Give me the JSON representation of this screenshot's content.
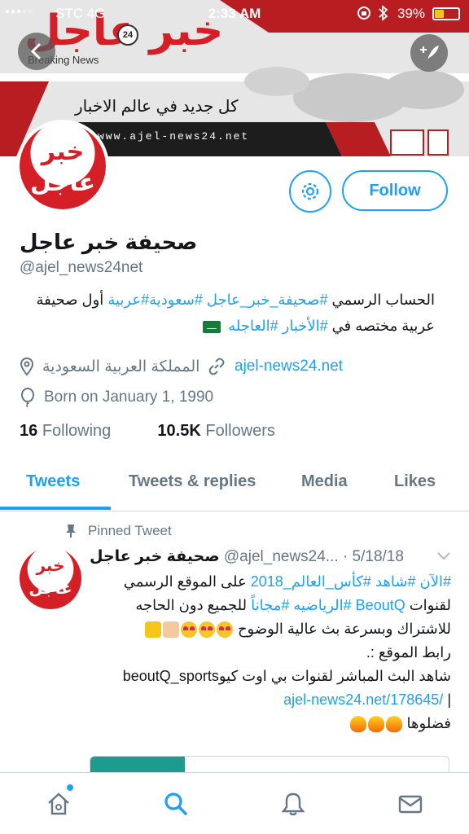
{
  "status_bar": {
    "signal_dots": "●●●○○",
    "carrier": "STC  4G",
    "time": "2:33 AM",
    "battery_percent": "39%",
    "battery_level": 0.39
  },
  "banner": {
    "logo_text": "خبر عاجل",
    "logo_badge": "24",
    "subtitle": "Breaking News",
    "tagline": "كل جديد في عالم الاخبار",
    "url": "www.ajel-news24.net"
  },
  "avatar": {
    "line1": "خبر",
    "line2": "عاجل"
  },
  "profile": {
    "follow_label": "Follow",
    "display_name": "صحيفة خبر عاجل",
    "handle": "@ajel_news24net",
    "bio_part1": "الحساب الرسمي ",
    "bio_tag1": "#صحيفة_خبر_عاجل",
    "bio_tag2": "#سعودية",
    "bio_tag3": "#عربية",
    "bio_part2": " أول صحيفة عربية مختصه في ",
    "bio_tag4": "#الأخبار",
    "bio_tag5": "#العاجله",
    "location": "المملكة العربية السعودية",
    "website": "ajel-news24.net",
    "born": "Born on January 1, 1990",
    "following_count": "16",
    "following_label": "Following",
    "followers_count": "10.5K",
    "followers_label": "Followers"
  },
  "tabs": [
    {
      "label": "Tweets",
      "active": true
    },
    {
      "label": "Tweets & replies",
      "active": false
    },
    {
      "label": "Media",
      "active": false
    },
    {
      "label": "Likes",
      "active": false
    }
  ],
  "tweet": {
    "pinned_label": "Pinned Tweet",
    "name": "صحيفة خبر عاجل",
    "handle": "@ajel_news24...",
    "date": "· 5/18/18",
    "tag1": "#الآن",
    "tag2": "#شاهد",
    "tag3": "#كأس_العالم_2018",
    "text1": " على الموقع الرسمي لقنوات ",
    "tag4": "BeoutQ",
    "tag5": "#الرياضيه",
    "tag6": "#مجاناً",
    "text2": " للجميع دون الحاجه للاشتراك وبسرعة بث عالية الوضوح",
    "line3": "رابط الموقع :.",
    "line4": "شاهد البث المباشر لقنوات بي اوت كيو",
    "line4_ltr": "beoutQ_sports",
    "link": "ajel-news24.net/178645/",
    "link_sep": " |",
    "line6": "فضلوها"
  },
  "bottom_nav": [
    {
      "name": "home",
      "icon": "home-icon",
      "has_dot": true
    },
    {
      "name": "search",
      "icon": "search-icon",
      "active": true
    },
    {
      "name": "notifications",
      "icon": "bell-icon"
    },
    {
      "name": "messages",
      "icon": "mail-icon"
    }
  ],
  "colors": {
    "accent": "#1da1f2",
    "brand_red": "#d51f26",
    "muted": "#657786"
  }
}
